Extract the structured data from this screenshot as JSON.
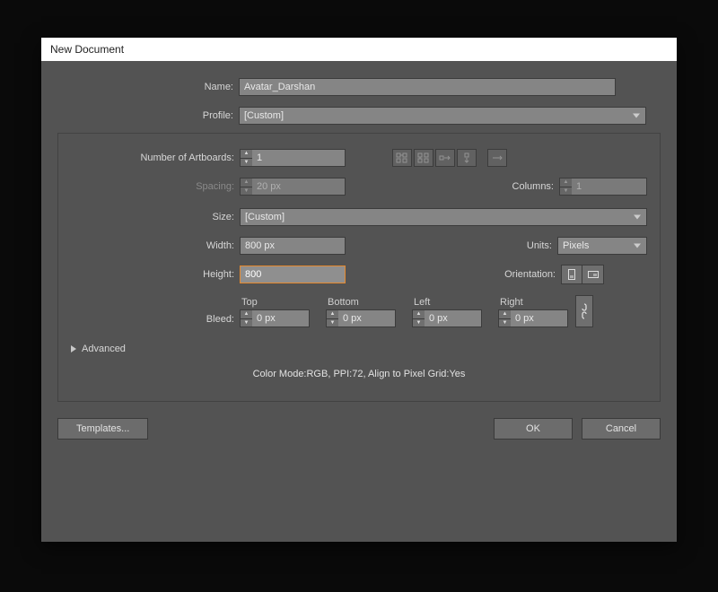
{
  "dialog": {
    "title": "New Document"
  },
  "fields": {
    "name_label": "Name:",
    "name_value": "Avatar_Darshan",
    "profile_label": "Profile:",
    "profile_value": "[Custom]",
    "artboards_label": "Number of Artboards:",
    "artboards_value": "1",
    "spacing_label": "Spacing:",
    "spacing_value": "20 px",
    "columns_label": "Columns:",
    "columns_value": "1",
    "size_label": "Size:",
    "size_value": "[Custom]",
    "width_label": "Width:",
    "width_value": "800 px",
    "units_label": "Units:",
    "units_value": "Pixels",
    "height_label": "Height:",
    "height_value": "800",
    "orientation_label": "Orientation:",
    "bleed_label": "Bleed:",
    "bleed_top_label": "Top",
    "bleed_bottom_label": "Bottom",
    "bleed_left_label": "Left",
    "bleed_right_label": "Right",
    "bleed_top_value": "0 px",
    "bleed_bottom_value": "0 px",
    "bleed_left_value": "0 px",
    "bleed_right_value": "0 px"
  },
  "advanced": {
    "label": "Advanced",
    "summary": "Color Mode:RGB, PPI:72, Align to Pixel Grid:Yes"
  },
  "buttons": {
    "templates": "Templates...",
    "ok": "OK",
    "cancel": "Cancel"
  }
}
